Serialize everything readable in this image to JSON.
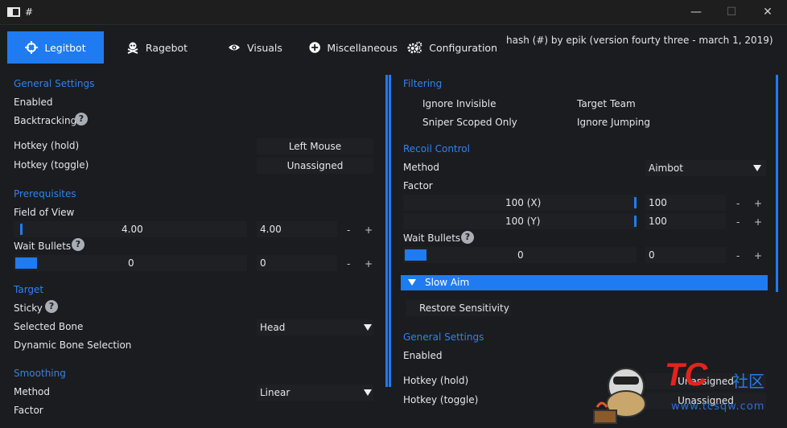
{
  "window": {
    "title": "#"
  },
  "tabs": [
    {
      "label": "Legitbot",
      "icon": "crosshair-icon",
      "active": true
    },
    {
      "label": "Ragebot",
      "icon": "skull-crossbones-icon"
    },
    {
      "label": "Visuals",
      "icon": "eye-icon"
    },
    {
      "label": "Miscellaneous",
      "icon": "plus-circle-icon"
    },
    {
      "label": "Configuration",
      "icon": "gears-icon"
    }
  ],
  "header_text": "hash (#) by epik (version fourty three - march 1, 2019)",
  "left": {
    "general": {
      "title": "General Settings",
      "enabled": "Enabled",
      "backtracking": "Backtracking",
      "hotkey_hold": "Hotkey (hold)",
      "hotkey_hold_value": "Left Mouse",
      "hotkey_toggle": "Hotkey (toggle)",
      "hotkey_toggle_value": "Unassigned"
    },
    "prereq": {
      "title": "Prerequisites",
      "fov": "Field of View",
      "fov_slider": "4.00",
      "fov_input": "4.00",
      "fov_fraction": 0.0,
      "wait_bullets": "Wait Bullets",
      "wait_slider": "0",
      "wait_input": "0"
    },
    "target": {
      "title": "Target",
      "sticky": "Sticky",
      "selected_bone": "Selected Bone",
      "selected_bone_value": "Head",
      "dynamic_bone": "Dynamic Bone Selection"
    },
    "smoothing": {
      "title": "Smoothing",
      "method": "Method",
      "method_value": "Linear",
      "factor": "Factor"
    }
  },
  "right": {
    "filtering": {
      "title": "Filtering",
      "ignore_invisible": "Ignore Invisible",
      "target_team": "Target Team",
      "sniper_scoped": "Sniper Scoped Only",
      "ignore_jumping": "Ignore Jumping"
    },
    "recoil": {
      "title": "Recoil Control",
      "method": "Method",
      "method_value": "Aimbot",
      "factor": "Factor",
      "x_slider": "100 (X)",
      "x_input": "100",
      "y_slider": "100 (Y)",
      "y_input": "100",
      "wait_bullets": "Wait Bullets",
      "wait_slider": "0",
      "wait_input": "0"
    },
    "slow_aim": {
      "label": "Slow Aim",
      "restore": "Restore Sensitivity"
    },
    "general": {
      "title": "General Settings",
      "enabled": "Enabled",
      "hotkey_hold": "Hotkey (hold)",
      "hotkey_hold_value": "Unassigned",
      "hotkey_toggle": "Hotkey (toggle)",
      "hotkey_toggle_value": "Unassigned"
    }
  },
  "controls": {
    "minus": "-",
    "plus": "+",
    "help": "?"
  },
  "watermark": {
    "logo_text": "TC",
    "cn_text": "社区",
    "url": "www.tcsqw.com"
  },
  "colors": {
    "accent": "#1f7bf2",
    "background": "#1b1c1f",
    "field": "#1f2024",
    "section_title": "#2e83f1"
  }
}
